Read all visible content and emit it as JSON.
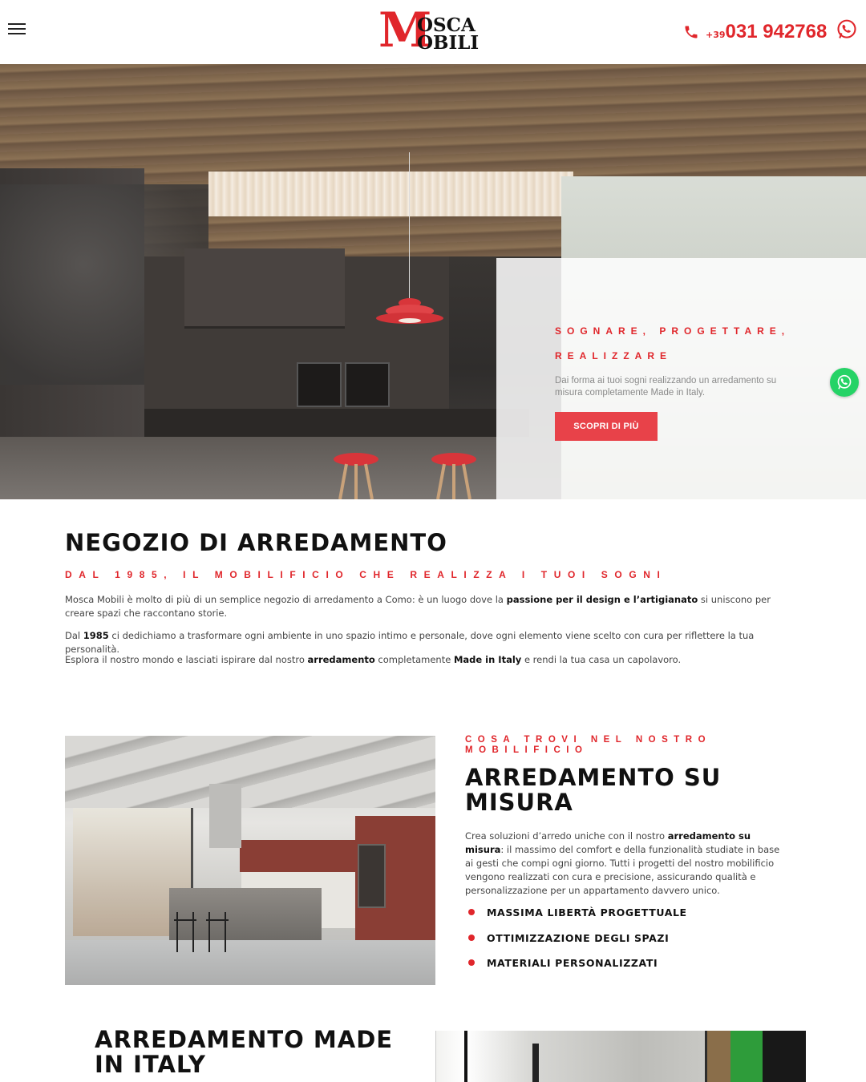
{
  "header": {
    "logo": {
      "letter": "M",
      "line1": "OSCA",
      "line2": "OBILI",
      "colors": {
        "red": "#e0262b",
        "black": "#111111"
      }
    },
    "phone": {
      "prefix": "+39",
      "number": "031 942768",
      "icon": "phone-icon"
    },
    "whatsapp_icon": "whatsapp-icon",
    "menu_icon": "hamburger-menu-icon"
  },
  "hero": {
    "title": "SOGNARE, PROGETTARE, REALIZZARE",
    "text": "Dai forma ai tuoi sogni realizzando un arredamento su misura completamente Made in Italy.",
    "cta_label": "SCOPRI DI PIÙ",
    "accent_color": "#e84249"
  },
  "intro": {
    "title": "NEGOZIO DI ARREDAMENTO",
    "subtitle": "DAL 1985, IL MOBILIFICIO CHE REALIZZA I TUOI SOGNI",
    "p1": {
      "a": "Mosca Mobili è molto di più di un semplice negozio di arredamento a Como: è un luogo dove la ",
      "b": "passione per il design e l’artigianato",
      "c": " si uniscono per creare spazi che raccontano storie."
    },
    "p2": {
      "a": "Dal ",
      "b": "1985",
      "c": " ci dedichiamo a trasformare ogni ambiente in uno spazio intimo e personale, dove ogni elemento viene scelto con cura per riflettere la tua personalità."
    },
    "p3": {
      "a": "Esplora il nostro mondo e lasciati ispirare dal nostro ",
      "b": "arredamento",
      "c": " completamente ",
      "d": "Made in Italy",
      "e": " e rendi la tua casa un capolavoro."
    }
  },
  "su_misura": {
    "eyebrow": "COSA TROVI NEL NOSTRO MOBILIFICIO",
    "title": "ARREDAMENTO SU MISURA",
    "text": {
      "a": "Crea soluzioni d’arredo uniche con il nostro ",
      "b": "arredamento su misura",
      "c": ": il massimo del comfort e della funzionalità studiate in base ai gesti che compi ogni giorno. Tutti i progetti del nostro mobilificio vengono realizzati con cura e precisione, assicurando qualità e personalizzazione per un appartamento davvero unico."
    },
    "features": [
      "MASSIMA LIBERTÀ PROGETTUALE",
      "OTTIMIZZAZIONE DEGLI SPAZI",
      "MATERIALI PERSONALIZZATI"
    ]
  },
  "made_in_italy": {
    "title": "ARREDAMENTO MADE IN ITALY"
  }
}
